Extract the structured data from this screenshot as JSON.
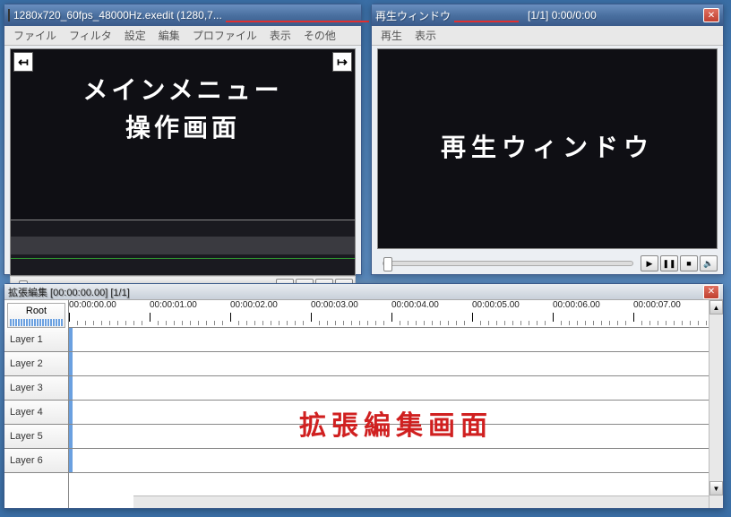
{
  "main_window": {
    "title": "1280x720_60fps_48000Hz.exedit (1280,7...",
    "menus": [
      "ファイル",
      "フィルタ",
      "設定",
      "編集",
      "プロファイル",
      "表示",
      "その他"
    ],
    "overlay_line1": "メインメニュー",
    "overlay_line2": "操作画面"
  },
  "play_window": {
    "title_prefix": "再生ウィンドウ",
    "title_suffix": "[1/1]  0:00/0:00",
    "menus": [
      "再生",
      "表示"
    ],
    "overlay": "再生ウィンドウ"
  },
  "timeline_window": {
    "title": "拡張編集 [00:00:00.00] [1/1]",
    "root_label": "Root",
    "layers": [
      "Layer  1",
      "Layer  2",
      "Layer  3",
      "Layer  4",
      "Layer  5",
      "Layer  6"
    ],
    "timestamps": [
      "00:00:00.00",
      "00:00:01.00",
      "00:00:02.00",
      "00:00:03.00",
      "00:00:04.00",
      "00:00:05.00",
      "00:00:06.00",
      "00:00:07.00"
    ],
    "overlay": "拡張編集画面"
  },
  "icons": {
    "minimize": "—",
    "maximize": "☐",
    "close": "✕",
    "prev_start": "⏮",
    "step_back": "◀|",
    "step_fwd": "|▶",
    "next_end": "⏭",
    "play": "▶",
    "pause": "❚❚",
    "stop": "■",
    "volume": "🔈",
    "left_arrow": "↤",
    "right_arrow": "↦",
    "scroll_up": "▲",
    "scroll_down": "▼"
  }
}
